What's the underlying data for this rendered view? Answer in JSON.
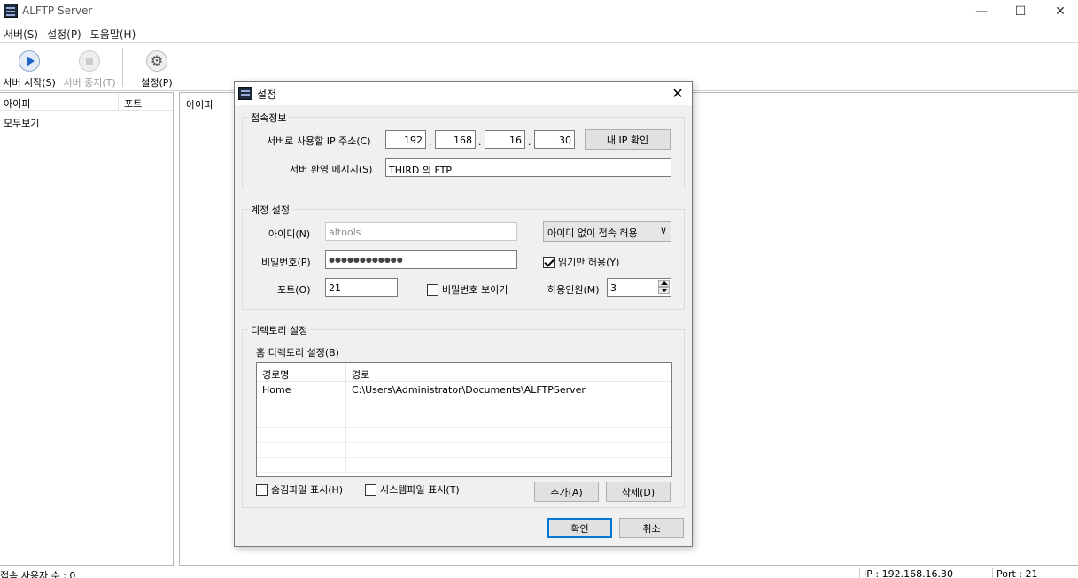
{
  "window": {
    "title": "ALFTP Server",
    "minimize": "—",
    "maximize": "☐",
    "close": "✕"
  },
  "menu": [
    "서버(S)",
    "설정(P)",
    "도움말(H)"
  ],
  "toolbar": {
    "start_label": "서버 시작(S)",
    "stop_label": "서버 중지(T)",
    "settings_label": "설정(P)",
    "gear_glyph": "⚙"
  },
  "left_pane": {
    "col_id": "아이피",
    "col_port": "포트",
    "row_all": "모두보기"
  },
  "right_pane": {
    "col_ip": "아이피"
  },
  "status": {
    "users": "접속 사용자 수 : 0",
    "ip": "IP : 192.168.16.30",
    "port": "Port : 21"
  },
  "dialog": {
    "title": "설정",
    "close": "✕",
    "connection": {
      "label": "접속정보",
      "ip_label": "서버로 사용할 IP 주소(C)",
      "ip": [
        "192",
        "168",
        "16",
        "30"
      ],
      "ip_dots": ".",
      "my_ip_button": "내 IP 확인",
      "welcome_label": "서버 환영 메시지(S)",
      "welcome_value": "THIRD 의 FTP"
    },
    "account": {
      "label": "계정 설정",
      "id_label": "아이디(N)",
      "id_value": "altools",
      "password_label": "비밀번호(P)",
      "password_value": "●●●●●●●●●●●●",
      "port_label": "포트(O)",
      "port_value": "21",
      "show_password": "비밀번호 보이기",
      "show_password_checked": false,
      "anon_select": "아이디 없이 접속 허용",
      "readonly": "읽기만 허용(Y)",
      "readonly_checked": true,
      "max_users_label": "허용인원(M)",
      "max_users_value": "3"
    },
    "directory": {
      "label": "디렉토리 설정",
      "home_label": "홈 디렉토리 설정(B)",
      "columns": [
        "경로명",
        "경로"
      ],
      "rows": [
        [
          "Home",
          "C:\\Users\\Administrator\\Documents\\ALFTPServer"
        ]
      ],
      "show_hidden": "숨김파일 표시(H)",
      "show_system": "시스템파일 표시(T)",
      "add_button": "추가(A)",
      "delete_button": "삭제(D)"
    },
    "ok_button": "확인",
    "cancel_button": "취소"
  }
}
